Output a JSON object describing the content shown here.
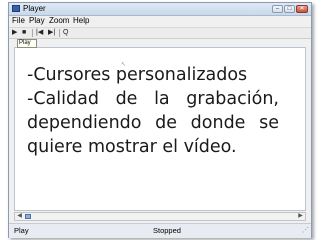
{
  "window": {
    "title": "Player",
    "controls": {
      "minimize": "–",
      "maximize": "□",
      "close": "✕"
    }
  },
  "menubar": {
    "items": [
      "File",
      "Play",
      "Zoom",
      "Help"
    ]
  },
  "toolbar": {
    "buttons": [
      {
        "name": "play-button",
        "glyph": "▶"
      },
      {
        "name": "stop-button",
        "glyph": "■"
      },
      {
        "name": "rewind-button",
        "glyph": "|◀"
      },
      {
        "name": "forward-button",
        "glyph": "▶|"
      },
      {
        "name": "zoom-button",
        "glyph": "Q"
      }
    ],
    "tooltip": "Play"
  },
  "content": {
    "lines": [
      "-Cursores personalizados",
      [
        "-Calidad",
        "de",
        "la",
        "grabación,"
      ],
      [
        "dependiendo",
        "de",
        "donde",
        "se"
      ],
      "quiere mostrar el vídeo."
    ]
  },
  "status": {
    "left": "Play",
    "middle": "Stopped"
  }
}
